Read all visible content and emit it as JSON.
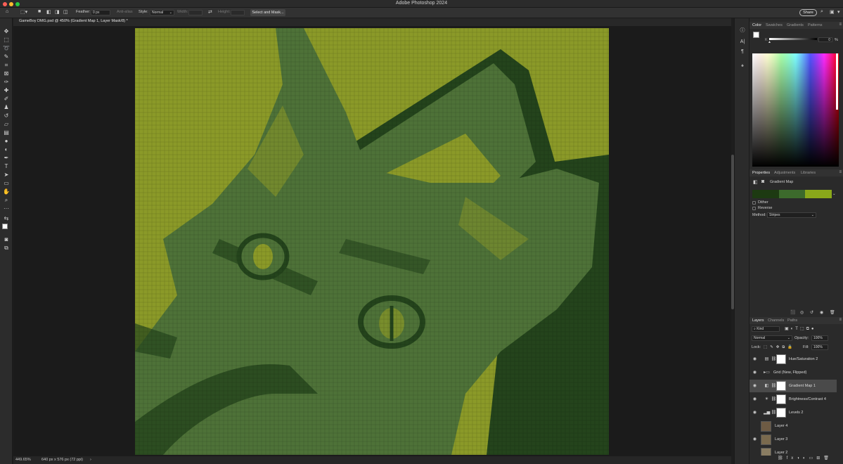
{
  "app": {
    "title": "Adobe Photoshop 2024"
  },
  "options_bar": {
    "feather_label": "Feather:",
    "feather_value": "0 px",
    "antialias_label": "Anti-alias",
    "style_label": "Style:",
    "style_value": "Normal",
    "width_label": "Width:",
    "height_label": "Height:",
    "select_mask_label": "Select and Mask...",
    "share_label": "Share"
  },
  "document": {
    "tab_title": "GameBoy DMG.psd @ 450% (Gradient Map 1, Layer Mask/8) *",
    "zoom": "449.65%",
    "doc_info": "640 px x 576 px (72 ppi)",
    "palette": {
      "light": "#8b9a28",
      "mid": "#4e7238",
      "dark": "#24441c"
    }
  },
  "color_panel": {
    "tabs": [
      "Color",
      "Swatches",
      "Gradients",
      "Patterns"
    ],
    "slider_label": "K",
    "slider_value": "0",
    "slider_unit": "%"
  },
  "properties_panel": {
    "tabs": [
      "Properties",
      "Adjustments",
      "Libraries"
    ],
    "title": "Gradient Map",
    "gradient_colors": [
      "#1d3a12",
      "#3c6a2c",
      "#8aa81a"
    ],
    "dither_label": "Dither",
    "reverse_label": "Reverse",
    "method_label": "Method:",
    "method_value": "Stripes"
  },
  "layers_panel": {
    "tabs": [
      "Layers",
      "Channels",
      "Paths"
    ],
    "kind_label": "Kind",
    "blend_mode": "Normal",
    "opacity_label": "Opacity:",
    "opacity_value": "100%",
    "lock_label": "Lock:",
    "fill_label": "Fill:",
    "fill_value": "100%",
    "layers": [
      {
        "name": "Hue/Saturation 2",
        "visible": true,
        "type": "adjustment",
        "icon": "hue-sat-icon"
      },
      {
        "name": "Grid (New, Flipped)",
        "visible": true,
        "type": "group",
        "icon": "folder-icon"
      },
      {
        "name": "Gradient Map 1",
        "visible": true,
        "type": "adjustment",
        "icon": "gradient-map-icon",
        "selected": true
      },
      {
        "name": "Brightness/Contrast 4",
        "visible": true,
        "type": "adjustment",
        "icon": "brightness-icon"
      },
      {
        "name": "Levels 2",
        "visible": true,
        "type": "adjustment",
        "icon": "levels-icon"
      },
      {
        "name": "Layer 4",
        "visible": false,
        "type": "pixel"
      },
      {
        "name": "Layer 3",
        "visible": true,
        "type": "pixel"
      },
      {
        "name": "Layer 2",
        "visible": false,
        "type": "pixel"
      }
    ]
  }
}
